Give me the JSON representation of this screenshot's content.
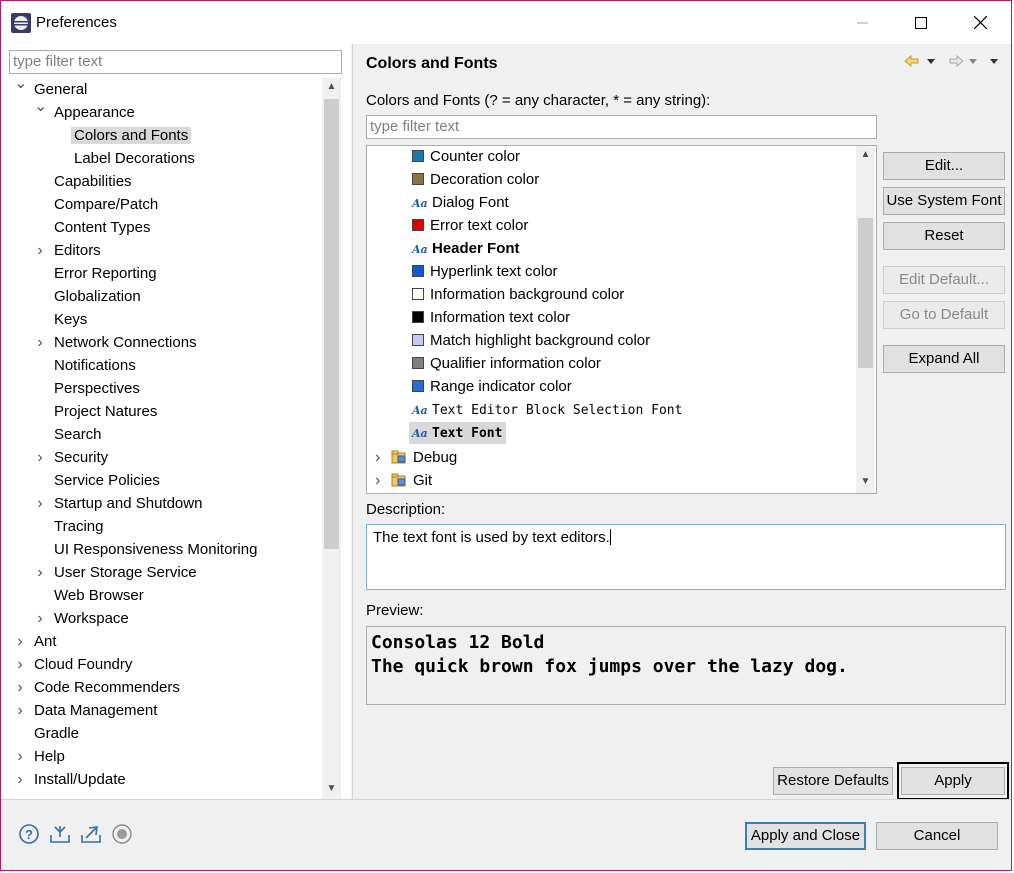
{
  "window": {
    "title": "Preferences"
  },
  "left": {
    "filter_placeholder": "type filter text",
    "tree": [
      {
        "label": "General",
        "chev": "v"
      },
      {
        "label": "Appearance",
        "chev": "v"
      },
      {
        "label": "Colors and Fonts",
        "chev": ""
      },
      {
        "label": "Label Decorations",
        "chev": ""
      },
      {
        "label": "Capabilities",
        "chev": ""
      },
      {
        "label": "Compare/Patch",
        "chev": ""
      },
      {
        "label": "Content Types",
        "chev": ""
      },
      {
        "label": "Editors",
        "chev": ">"
      },
      {
        "label": "Error Reporting",
        "chev": ""
      },
      {
        "label": "Globalization",
        "chev": ""
      },
      {
        "label": "Keys",
        "chev": ""
      },
      {
        "label": "Network Connections",
        "chev": ">"
      },
      {
        "label": "Notifications",
        "chev": ""
      },
      {
        "label": "Perspectives",
        "chev": ""
      },
      {
        "label": "Project Natures",
        "chev": ""
      },
      {
        "label": "Search",
        "chev": ""
      },
      {
        "label": "Security",
        "chev": ">"
      },
      {
        "label": "Service Policies",
        "chev": ""
      },
      {
        "label": "Startup and Shutdown",
        "chev": ">"
      },
      {
        "label": "Tracing",
        "chev": ""
      },
      {
        "label": "UI Responsiveness Monitoring",
        "chev": ""
      },
      {
        "label": "User Storage Service",
        "chev": ">"
      },
      {
        "label": "Web Browser",
        "chev": ""
      },
      {
        "label": "Workspace",
        "chev": ">"
      },
      {
        "label": "Ant",
        "chev": ">"
      },
      {
        "label": "Cloud Foundry",
        "chev": ">"
      },
      {
        "label": "Code Recommenders",
        "chev": ">"
      },
      {
        "label": "Data Management",
        "chev": ">"
      },
      {
        "label": "Gradle",
        "chev": ""
      },
      {
        "label": "Help",
        "chev": ">"
      },
      {
        "label": "Install/Update",
        "chev": ">"
      }
    ]
  },
  "right": {
    "title": "Colors and Fonts",
    "filter_label": "Colors and Fonts (? = any character, * = any string):",
    "filter_placeholder": "type filter text",
    "items": [
      {
        "label": "Counter color",
        "kind": "color",
        "color": "#1b78a8"
      },
      {
        "label": "Decoration color",
        "kind": "color",
        "color": "#8c7441"
      },
      {
        "label": "Dialog Font",
        "kind": "font"
      },
      {
        "label": "Error text color",
        "kind": "color",
        "color": "#e00000"
      },
      {
        "label": "Header Font",
        "kind": "font",
        "bold": true
      },
      {
        "label": "Hyperlink text color",
        "kind": "color",
        "color": "#0f5bd0"
      },
      {
        "label": "Information background color",
        "kind": "color",
        "color": "#fffff0"
      },
      {
        "label": "Information text color",
        "kind": "color",
        "color": "#000000"
      },
      {
        "label": "Match highlight background color",
        "kind": "color",
        "color": "#c8c8f5"
      },
      {
        "label": "Qualifier information color",
        "kind": "color",
        "color": "#808080"
      },
      {
        "label": "Range indicator color",
        "kind": "color",
        "color": "#1f6fd6"
      },
      {
        "label": "Text Editor Block Selection Font",
        "kind": "font",
        "mono": true
      },
      {
        "label": "Text Font",
        "kind": "font",
        "mono": true,
        "bold": true,
        "selected": true
      }
    ],
    "categories": [
      {
        "label": "Debug"
      },
      {
        "label": "Git"
      }
    ],
    "buttons": {
      "edit": "Edit...",
      "use_system_font": "Use System Font",
      "reset": "Reset",
      "edit_default": "Edit Default...",
      "go_to_default": "Go to Default",
      "expand_all": "Expand All"
    },
    "description_label": "Description:",
    "description_text": "The text font is used by text editors.",
    "preview_label": "Preview:",
    "preview_line1": "Consolas 12 Bold",
    "preview_line2": "The quick brown fox jumps over the lazy dog.",
    "restore_defaults": "Restore Defaults",
    "apply": "Apply"
  },
  "footer": {
    "apply_and_close": "Apply and Close",
    "cancel": "Cancel"
  }
}
